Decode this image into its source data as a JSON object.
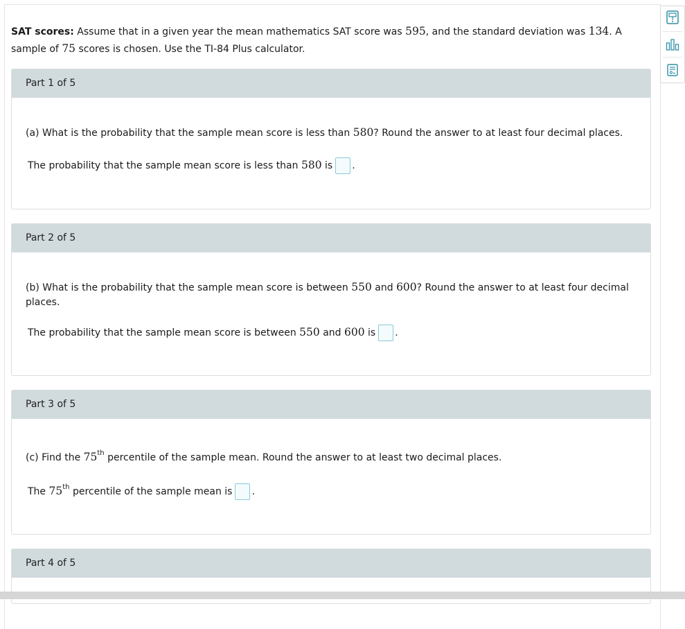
{
  "problem": {
    "title": "SAT scores:",
    "text_1": "Assume that in a given year the mean mathematics SAT score was",
    "mean": "595",
    "text_2": ", and the standard deviation was",
    "sd": "134",
    "text_3": ". A sample of",
    "n": "75",
    "text_4": "scores is chosen. Use the TI-84 Plus calculator."
  },
  "parts": [
    {
      "header": "Part 1 of 5",
      "question": {
        "a": "(a) What is the probability that the sample mean score is less than",
        "v1": "580",
        "b": "? Round the answer to at least four decimal places."
      },
      "answer": {
        "a": "The probability that the sample mean score is less than",
        "v1": "580",
        "b": "is",
        "end": "."
      }
    },
    {
      "header": "Part 2 of 5",
      "question": {
        "a": "(b) What is the probability that the sample mean score is between",
        "v1": "550",
        "mid": "and",
        "v2": "600",
        "b": "? Round the answer to at least four decimal places."
      },
      "answer": {
        "a": "The probability that the sample mean score is between",
        "v1": "550",
        "mid": "and",
        "v2": "600",
        "b": "is",
        "end": "."
      }
    },
    {
      "header": "Part 3 of 5",
      "question": {
        "a": "(c) Find the",
        "v1": "75",
        "sup": "th",
        "b": "percentile of the sample mean. Round the answer to at least two decimal places."
      },
      "answer": {
        "a": "The",
        "v1": "75",
        "sup": "th",
        "b": "percentile of the sample mean is",
        "end": "."
      }
    },
    {
      "header": "Part 4 of 5"
    }
  ],
  "tools": [
    {
      "icon": "calculator-icon"
    },
    {
      "icon": "bar-chart-icon"
    },
    {
      "icon": "data-table-icon"
    }
  ],
  "colors": {
    "part_header_bg": "#d1dadd",
    "answer_box_border": "#8bc8d8",
    "icon_color": "#2e8fa6"
  }
}
